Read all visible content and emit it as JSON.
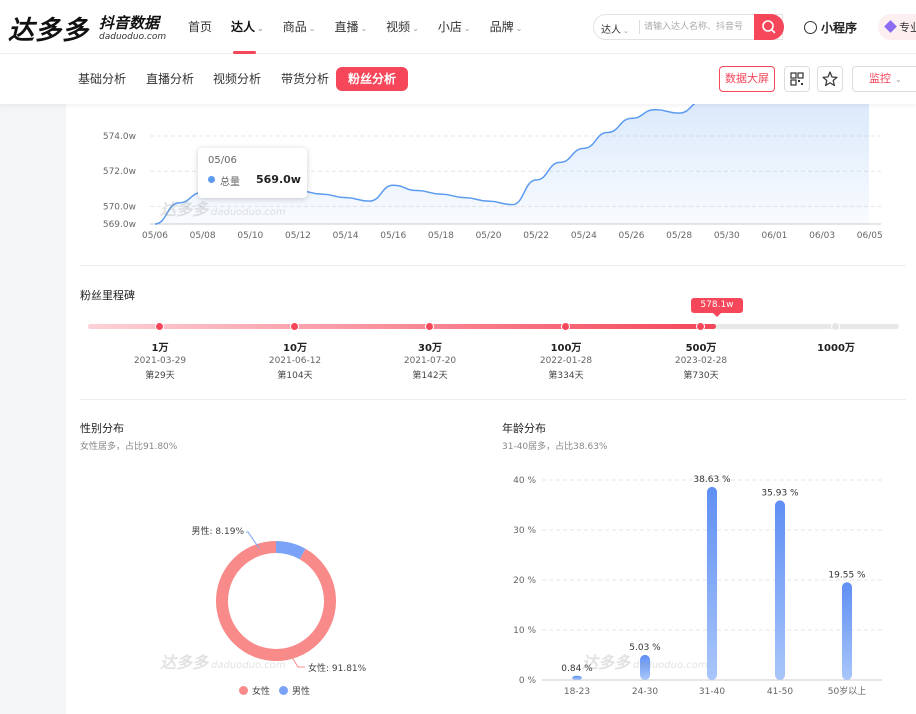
{
  "header": {
    "logo_main": "达多多",
    "logo_sub": "抖音数据",
    "logo_domain": "daduoduo.com",
    "nav": [
      {
        "label": "首页",
        "chevron": false
      },
      {
        "label": "达人",
        "chevron": true
      },
      {
        "label": "商品",
        "chevron": true
      },
      {
        "label": "直播",
        "chevron": true
      },
      {
        "label": "视频",
        "chevron": true
      },
      {
        "label": "小店",
        "chevron": true
      },
      {
        "label": "品牌",
        "chevron": true
      }
    ],
    "search": {
      "type": "达人",
      "placeholder": "请输入达人名称、抖音号"
    },
    "mini_program": "小程序",
    "pro": "专业"
  },
  "subnav": {
    "tabs": [
      "基础分析",
      "直播分析",
      "视频分析",
      "带货分析",
      "粉丝分析"
    ],
    "active_tab": "粉丝分析",
    "data_screen": "数据大屏",
    "monitor": "监控"
  },
  "watermark": {
    "cn": "达多多",
    "en": "daduoduo.com"
  },
  "tooltip": {
    "date": "05/06",
    "label": "总量",
    "value": "569.0w"
  },
  "milestones": {
    "title": "粉丝里程碑",
    "current": "578.1w",
    "items": [
      {
        "label": "1万",
        "date": "2021-03-29",
        "days": "第29天",
        "reached": true
      },
      {
        "label": "10万",
        "date": "2021-06-12",
        "days": "第104天",
        "reached": true
      },
      {
        "label": "30万",
        "date": "2021-07-20",
        "days": "第142天",
        "reached": true
      },
      {
        "label": "100万",
        "date": "2022-01-28",
        "days": "第334天",
        "reached": true
      },
      {
        "label": "500万",
        "date": "2023-02-28",
        "days": "第730天",
        "reached": true
      },
      {
        "label": "1000万",
        "date": "",
        "days": "",
        "reached": false
      }
    ]
  },
  "gender": {
    "title": "性别分布",
    "subtitle": "女性居多，占比91.80%",
    "male_label": "男性: 8.19%",
    "female_label": "女性: 91.81%",
    "legend": [
      "女性",
      "男性"
    ]
  },
  "age": {
    "title": "年龄分布",
    "subtitle": "31-40居多，占比38.63%"
  },
  "colors": {
    "accent": "#f5465a",
    "line": "#5b9bf0",
    "female": "#f98a8a",
    "male": "#7aa2f7",
    "bar": "#6b9cf5"
  },
  "chart_data": [
    {
      "type": "area",
      "x": [
        "05/06",
        "05/07",
        "05/08",
        "05/09",
        "05/10",
        "05/11",
        "05/12",
        "05/13",
        "05/14",
        "05/15",
        "05/16",
        "05/17",
        "05/18",
        "05/19",
        "05/20",
        "05/21",
        "05/22",
        "05/23",
        "05/24",
        "05/25",
        "05/26",
        "05/27",
        "05/28",
        "05/29"
      ],
      "xticks": [
        "05/06",
        "05/08",
        "05/10",
        "05/12",
        "05/14",
        "05/16",
        "05/18",
        "05/20",
        "05/22",
        "05/24",
        "05/26",
        "05/28",
        "05/30",
        "06/01",
        "06/03",
        "06/05"
      ],
      "yticks": [
        "569.0w",
        "570.0w",
        "572.0w",
        "574.0w"
      ],
      "ytick_values": [
        569,
        570,
        572,
        574
      ],
      "y": [
        569.0,
        570.2,
        570.8,
        570.9,
        571.2,
        571.1,
        570.9,
        570.7,
        570.5,
        570.3,
        571.2,
        570.9,
        570.7,
        570.5,
        570.3,
        570.1,
        571.5,
        572.5,
        573.3,
        574.2,
        575.0,
        575.5,
        575.3,
        576.0
      ],
      "ylim": [
        569,
        575.5
      ]
    },
    {
      "type": "pie",
      "categories": [
        "女性",
        "男性"
      ],
      "values": [
        91.81,
        8.19
      ]
    },
    {
      "type": "bar",
      "categories": [
        "18-23",
        "24-30",
        "31-40",
        "41-50",
        "50岁以上"
      ],
      "values": [
        0.84,
        5.03,
        38.63,
        35.93,
        19.55
      ],
      "value_labels": [
        "0.84 %",
        "5.03 %",
        "38.63 %",
        "35.93 %",
        "19.55 %"
      ],
      "yticks": [
        "0 %",
        "10 %",
        "20 %",
        "30 %",
        "40 %"
      ],
      "ylim": [
        0,
        40
      ]
    }
  ]
}
